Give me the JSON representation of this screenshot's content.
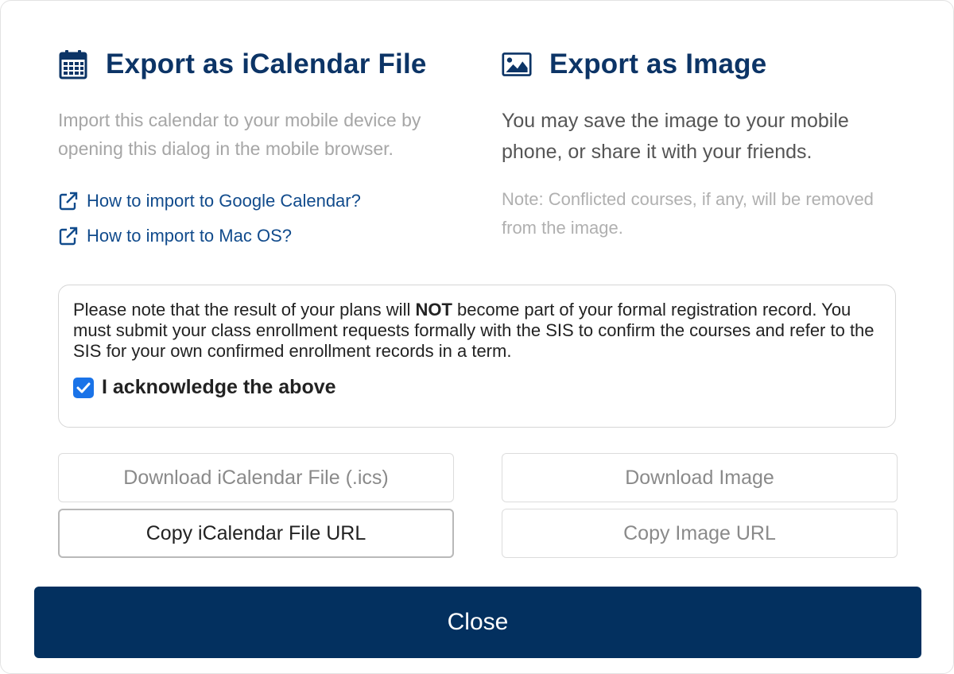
{
  "ical": {
    "title": "Export as iCalendar File",
    "icon": "calendar-icon",
    "description": "Import this calendar to your mobile device by opening this dialog in the mobile browser.",
    "links": [
      {
        "label": "How to import to Google Calendar?",
        "icon": "external-link-icon"
      },
      {
        "label": "How to import to Mac OS?",
        "icon": "external-link-icon"
      }
    ]
  },
  "image": {
    "title": "Export as Image",
    "icon": "image-icon",
    "description": "You may save the image to your mobile phone, or share it with your friends.",
    "note": "Note: Conflicted courses, if any, will be removed from the image."
  },
  "notice": {
    "text_before": "Please note that the result of your plans will ",
    "text_bold": "NOT",
    "text_after": " become part of your formal registration record. You must submit your class enrollment requests formally with the SIS to confirm the courses and refer to the SIS for your own confirmed enrollment records in a term.",
    "acknowledge_label": "I acknowledge the above",
    "acknowledged": true
  },
  "buttons": {
    "download_ics": "Download iCalendar File (.ics)",
    "copy_ics_url": "Copy iCalendar File URL",
    "download_image": "Download Image",
    "copy_image_url": "Copy Image URL",
    "close": "Close"
  },
  "colors": {
    "heading": "#0c3466",
    "link": "#114b8c",
    "close_bg": "#03305f",
    "checkbox": "#1a73e8"
  }
}
